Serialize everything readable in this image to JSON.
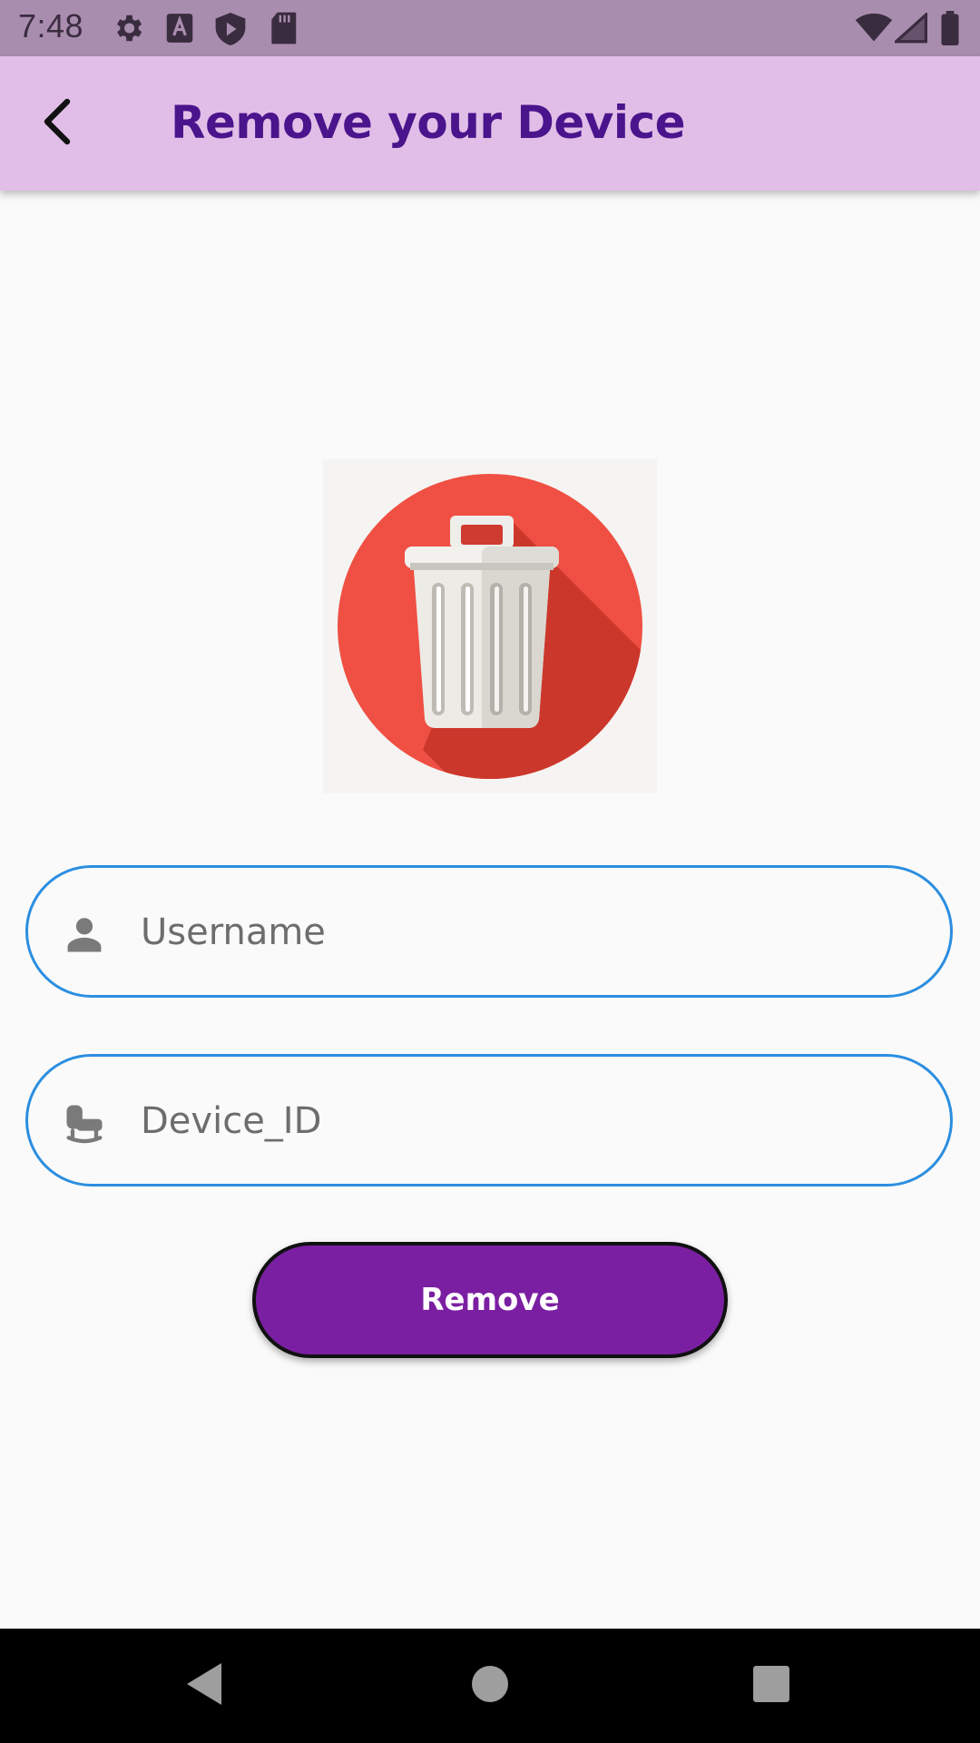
{
  "status_bar": {
    "time": "7:48",
    "left_icons": [
      "settings-icon",
      "font-a-icon",
      "shield-play-icon",
      "sd-card-icon"
    ],
    "right_icons": [
      "wifi-icon",
      "signal-icon",
      "battery-icon"
    ]
  },
  "app_bar": {
    "title": "Remove your Device",
    "back_icon": "chevron-left-icon"
  },
  "illustration": {
    "icon": "trash-can-icon",
    "circle_color": "#ef5043"
  },
  "form": {
    "username": {
      "icon": "person-icon",
      "placeholder": "Username",
      "value": ""
    },
    "device_id": {
      "icon": "device-chair-icon",
      "placeholder": "Device_ID",
      "value": ""
    },
    "submit_label": "Remove"
  },
  "nav_bar": {
    "buttons": [
      "back-triangle-icon",
      "home-circle-icon",
      "recents-square-icon"
    ]
  },
  "colors": {
    "status_bar": "#a98daf",
    "app_bar": "#e1bee7",
    "title": "#4a148c",
    "field_border": "#2b8ee0",
    "button": "#7b1fa2"
  }
}
